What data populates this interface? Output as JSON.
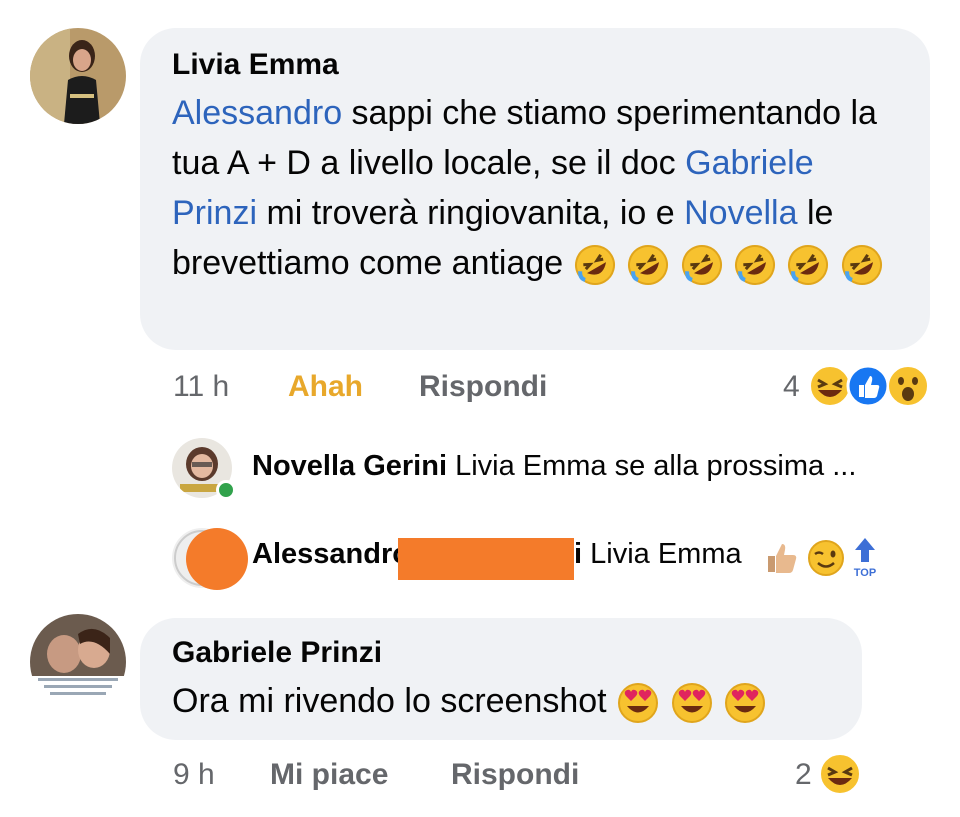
{
  "colors": {
    "bubble": "#f0f2f5",
    "mention": "#2d64bc",
    "meta": "#65676b",
    "haha_reaction_text": "#e8a82b",
    "like_blue": "#1877f2",
    "redaction": "#f47b2a"
  },
  "comments": [
    {
      "author": "Livia Emma",
      "segments": [
        {
          "text": "Alessandro",
          "mention": true
        },
        {
          "text": " sappi che stiamo sperimentando la tua A + D a livello locale, se il doc ",
          "mention": false
        },
        {
          "text": "Gabriele Prinzi",
          "mention": true
        },
        {
          "text": " mi troverà ringiovanita, io e ",
          "mention": false
        },
        {
          "text": "Novella",
          "mention": true
        },
        {
          "text": " le brevettiamo come antiage",
          "mention": false
        }
      ],
      "trailing_emojis": [
        "rolling-on-floor-laughing",
        "rolling-on-floor-laughing",
        "rolling-on-floor-laughing",
        "rolling-on-floor-laughing",
        "rolling-on-floor-laughing",
        "rolling-on-floor-laughing"
      ],
      "time": "11 h",
      "reaction_label": "Ahah",
      "reply_label": "Rispondi",
      "reaction_count": "4",
      "reaction_icons": [
        "haha",
        "like",
        "wow"
      ]
    },
    {
      "author": "Gabriele Prinzi",
      "text": "Ora mi rivendo lo screenshot",
      "trailing_emojis": [
        "heart-eyes",
        "heart-eyes",
        "heart-eyes"
      ],
      "time": "9 h",
      "reaction_label": "Mi piace",
      "reply_label": "Rispondi",
      "reaction_count": "2",
      "reaction_icons": [
        "haha"
      ]
    }
  ],
  "replies": [
    {
      "author": "Novella Gerini",
      "preview": "Livia Emma se alla prossima ..."
    },
    {
      "author": "Alessandro",
      "author_suffix": "i",
      "preview": "Livia Emma",
      "emojis": [
        "thumbs-up",
        "wink",
        "top-arrow"
      ],
      "top_label": "TOP"
    }
  ]
}
